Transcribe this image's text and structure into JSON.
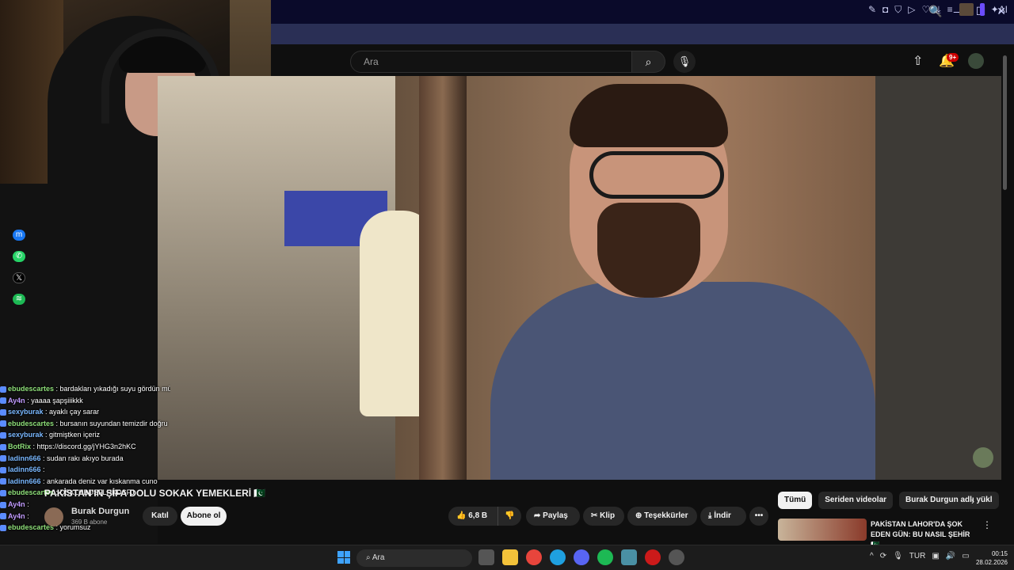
{
  "browser": {
    "window_controls": [
      "🔍",
      "—",
      "☐",
      "✕"
    ],
    "ai_label": "AI"
  },
  "youtube": {
    "search_placeholder": "Ara",
    "notification_badge": "9+"
  },
  "social_icons": [
    "messenger-icon",
    "whatsapp-icon",
    "x-icon",
    "spotify-icon"
  ],
  "chat": [
    {
      "user": "ebudescartes",
      "msg": "bardakları yıkadığı suyu gördün mü",
      "cls": ""
    },
    {
      "user": "Ay4n",
      "msg": "yaaaa şapşiiikkk",
      "cls": "u3"
    },
    {
      "user": "sexyburak",
      "msg": "ayaklı çay sarar",
      "cls": "u2"
    },
    {
      "user": "ebudescartes",
      "msg": "bursanın suyundan temizdir doğru",
      "cls": ""
    },
    {
      "user": "sexyburak",
      "msg": "gitmiştken içeriz",
      "cls": "u2"
    },
    {
      "user": "BotRix",
      "msg": "https://discord.gg/jYHG3n2hKC",
      "cls": ""
    },
    {
      "user": "ladinn666",
      "msg": "sudan rakı akıyo burada",
      "cls": "u2"
    },
    {
      "user": "ladinn666",
      "msg": "",
      "cls": "u2"
    },
    {
      "user": "ladinn666",
      "msg": "ankarada deniz var kıskanma cuno",
      "cls": "u2"
    },
    {
      "user": "ebudescartes",
      "msg": "DSKLHBDSFLHKDSFJ",
      "cls": ""
    },
    {
      "user": "Ay4n",
      "msg": "",
      "cls": "u3"
    },
    {
      "user": "Ay4n",
      "msg": "",
      "cls": "u3"
    },
    {
      "user": "ebudescartes",
      "msg": "yorumsuz",
      "cls": ""
    }
  ],
  "video": {
    "title": "PAKİSTAN'IN ŞİFA DOLU SOKAK YEMEKLERİ 🇵🇰",
    "channel": "Burak Durgun",
    "subscribers": "369 B abone",
    "join": "Katıl",
    "subscribe": "Abone ol",
    "likes": "6,8 B",
    "share": "Paylaş",
    "clip": "Klip",
    "thanks": "Teşekkürler",
    "download": "İndir"
  },
  "chips": [
    "Tümü",
    "Seriden videolar",
    "Burak Durgun adlı yükl"
  ],
  "recommended": {
    "title": "PAKİSTAN LAHOR'DA ŞOK EDEN GÜN: BU NASIL ŞEHİR 🇵🇰"
  },
  "taskbar": {
    "search": "Ara",
    "lang": "TUR",
    "time": "00:15",
    "date": "28.02.2026"
  },
  "colors": {
    "youtube_bg": "#0f0f0f",
    "browser_titlebar": "#0a0a2a",
    "browser_toolbar": "#2a2f55",
    "notification_red": "#cc0000",
    "chat_user_green": "#8fe07a"
  }
}
